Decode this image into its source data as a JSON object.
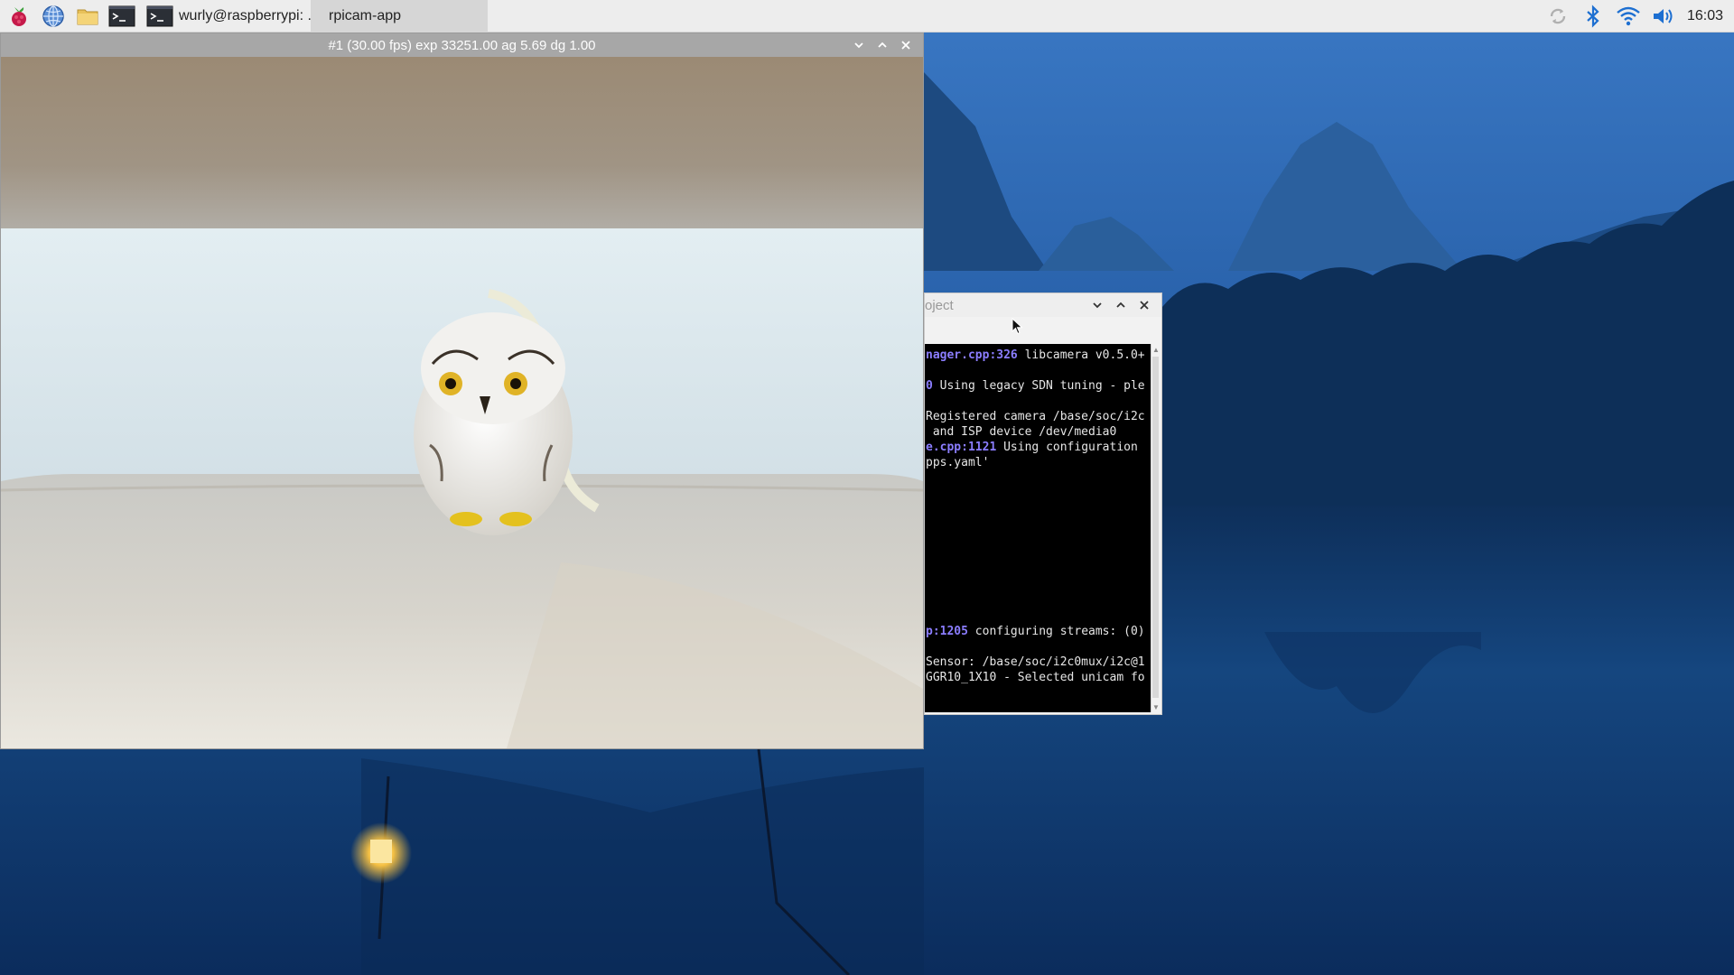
{
  "taskbar": {
    "launcher_icons": [
      "raspberry-menu-icon",
      "web-browser-icon",
      "file-manager-icon",
      "terminal-icon"
    ],
    "tasks": [
      {
        "label": "wurly@raspberrypi: ...",
        "icon": "terminal-icon"
      },
      {
        "label": "rpicam-app",
        "active": true
      }
    ],
    "tray_icons": [
      "update-sync-icon",
      "bluetooth-icon",
      "wifi-icon",
      "volume-icon"
    ],
    "clock": "16:03"
  },
  "preview_window": {
    "title": "#1 (30.00 fps) exp 33251.00 ag 5.69 dg 1.00",
    "controls": [
      "minimize",
      "maximize",
      "close"
    ]
  },
  "terminal_window": {
    "title": "oject",
    "lines": [
      {
        "hl": "nager.cpp:326",
        "text": " libcamera v0.5.0+"
      },
      {
        "gap": true
      },
      {
        "hl": "0",
        "text": " Using legacy SDN tuning - ple"
      },
      {
        "gap": true
      },
      {
        "hl": "",
        "text": "Registered camera /base/soc/i2c"
      },
      {
        "hl": "",
        "text": " and ISP device /dev/media0"
      },
      {
        "hl": "e.cpp:1121",
        "text": " Using configuration"
      },
      {
        "hl": "",
        "text": "pps.yaml'"
      },
      {
        "gap": true
      },
      {
        "gap": true
      },
      {
        "gap": true
      },
      {
        "gap": true
      },
      {
        "gap": true
      },
      {
        "gap": true
      },
      {
        "gap": true
      },
      {
        "gap": true
      },
      {
        "gap": true
      },
      {
        "gap": true
      },
      {
        "hl": "p:1205",
        "text": " configuring streams: (0)"
      },
      {
        "gap": true
      },
      {
        "hl": "",
        "text": "Sensor: /base/soc/i2c0mux/i2c@1"
      },
      {
        "hl": "",
        "text": "GGR10_1X10 - Selected unicam fo"
      }
    ]
  },
  "colors": {
    "taskbar": "#ededed",
    "titlebar_inactive": "#a7a7a7",
    "terminal_highlight": "#8b7dff",
    "wallpaper_blue": "#2a5fa6"
  }
}
